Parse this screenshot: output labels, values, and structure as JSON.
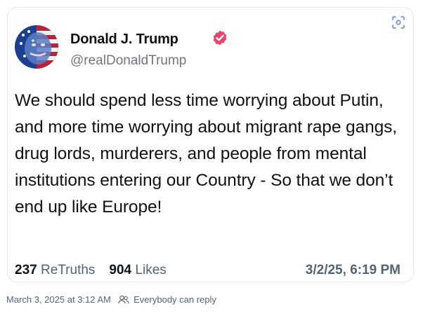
{
  "post": {
    "author_name": "Donald J. Trump",
    "author_handle": "@realDonaldTrump",
    "text": "We should spend less time worrying about Putin, and more time worrying about migrant rape gangs, drug lords, murderers, and people from mental institutions entering our Country - So that we don’t end up like Europe!",
    "retruths_count": "237",
    "retruths_label": "ReTruths",
    "likes_count": "904",
    "likes_label": "Likes",
    "date": "3/2/25, 6:19 PM"
  },
  "footer": {
    "timestamp": "March 3, 2025 at 3:12 AM",
    "reply_setting": "Everybody can reply"
  },
  "icons": {
    "verified": "verified-badge-icon",
    "scan": "scan-icon",
    "reply_audience": "people-icon"
  },
  "colors": {
    "verified_badge": "#e8456b",
    "muted_text": "#536471",
    "card_border": "#e6e6e6"
  }
}
